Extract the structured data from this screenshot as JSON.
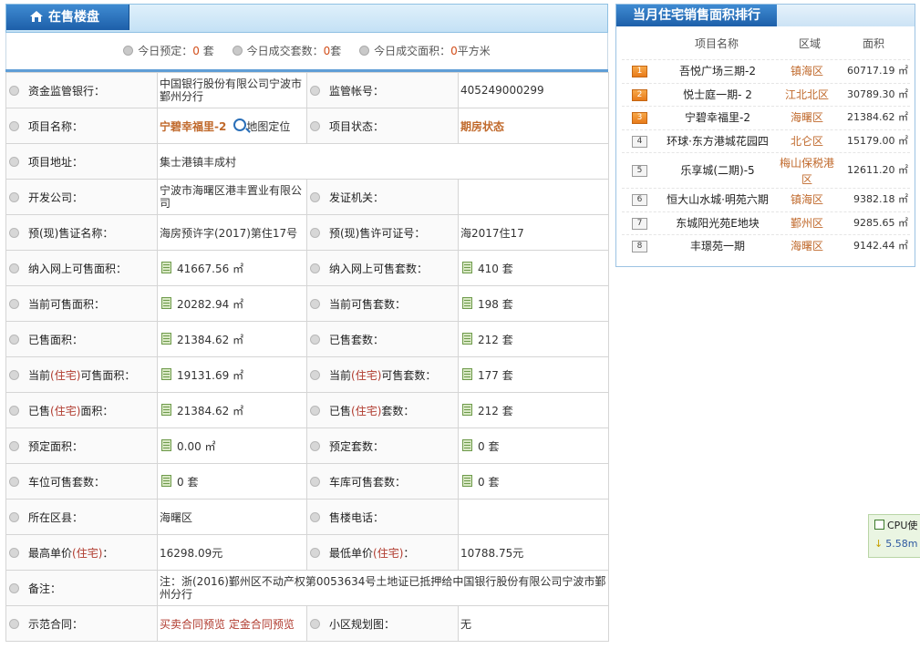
{
  "left_panel": {
    "tab_title": "在售楼盘",
    "stats": [
      {
        "label": "今日预定：",
        "value": "0",
        "unit": " 套"
      },
      {
        "label": "今日成交套数：",
        "value": "0",
        "unit": "套"
      },
      {
        "label": "今日成交面积：",
        "value": "0",
        "unit": "平方米"
      }
    ],
    "rows": {
      "bank_label": "资金监管银行：",
      "bank_value": "中国银行股份有限公司宁波市鄞州分行",
      "account_label": "监管帐号：",
      "account_value": "405249000299",
      "project_label": "项目名称：",
      "project_value": "宁碧幸福里-2",
      "map_link": "地图定位",
      "status_label": "项目状态：",
      "status_value": "期房状态",
      "address_label": "项目地址：",
      "address_value": "集士港镇丰成村",
      "developer_label": "开发公司：",
      "developer_value": "宁波市海曙区港丰置业有限公司",
      "issuer_label": "发证机关：",
      "issuer_value": "",
      "permit_name_label": "预(现)售证名称：",
      "permit_name_value": "海房预许字(2017)第住17号",
      "permit_no_label": "预(现)售许可证号：",
      "permit_no_value": "海2017住17",
      "online_area_label": "纳入网上可售面积：",
      "online_area_value": "41667.56 ㎡",
      "online_units_label": "纳入网上可售套数：",
      "online_units_value": "410 套",
      "cur_area_label": "当前可售面积：",
      "cur_area_value": "20282.94 ㎡",
      "cur_units_label": "当前可售套数：",
      "cur_units_value": "198 套",
      "sold_area_label": "已售面积：",
      "sold_area_value": "21384.62 ㎡",
      "sold_units_label": "已售套数：",
      "sold_units_value": "212 套",
      "cur_res_area_label_a": "当前",
      "cur_res_area_label_b": "(住宅)",
      "cur_res_area_label_c": "可售面积：",
      "cur_res_area_value": "19131.69 ㎡",
      "cur_res_units_label_a": "当前",
      "cur_res_units_label_b": "(住宅)",
      "cur_res_units_label_c": "可售套数：",
      "cur_res_units_value": "177 套",
      "sold_res_area_label_a": "已售",
      "sold_res_area_label_b": "(住宅)",
      "sold_res_area_label_c": "面积：",
      "sold_res_area_value": "21384.62 ㎡",
      "sold_res_units_label_a": "已售",
      "sold_res_units_label_b": "(住宅)",
      "sold_res_units_label_c": "套数：",
      "sold_res_units_value": "212 套",
      "reserved_area_label": "预定面积：",
      "reserved_area_value": "0.00 ㎡",
      "reserved_units_label": "预定套数：",
      "reserved_units_value": "0 套",
      "parking_label": "车位可售套数：",
      "parking_value": "0 套",
      "garage_label": "车库可售套数：",
      "garage_value": "0 套",
      "district_label": "所在区县：",
      "district_value": "海曙区",
      "phone_label": "售楼电话：",
      "phone_value": "",
      "max_price_label_a": "最高单价",
      "max_price_label_b": "(住宅)",
      "max_price_label_c": "：",
      "max_price_value": "16298.09元",
      "min_price_label_a": "最低单价",
      "min_price_label_b": "(住宅)",
      "min_price_label_c": "：",
      "min_price_value": "10788.75元",
      "note_label": "备注：",
      "note_value": "注：浙(2016)鄞州区不动产权第0053634号土地证已抵押给中国银行股份有限公司宁波市鄞州分行",
      "contract_label": "示范合同：",
      "contract_link1": "买卖合同预览",
      "contract_link2": "定金合同预览",
      "plan_label": "小区规划图：",
      "plan_value": "无"
    }
  },
  "right_panel": {
    "title": "当月住宅销售面积排行",
    "col_name": "项目名称",
    "col_area": "区域",
    "col_sqm": "面积",
    "items": [
      {
        "rank": "1",
        "name": "吾悦广场三期-2",
        "district": "镇海区",
        "sqm": "60717.19 ㎡"
      },
      {
        "rank": "2",
        "name": "悦士庭一期- 2",
        "district": "江北北区",
        "sqm": "30789.30 ㎡"
      },
      {
        "rank": "3",
        "name": "宁碧幸福里-2",
        "district": "海曙区",
        "sqm": "21384.62 ㎡"
      },
      {
        "rank": "4",
        "name": "环球·东方港城花园四",
        "district": "北仑区",
        "sqm": "15179.00 ㎡"
      },
      {
        "rank": "5",
        "name": "乐享城(二期)-5",
        "district": "梅山保税港区",
        "sqm": "12611.20 ㎡"
      },
      {
        "rank": "6",
        "name": "恒大山水城·明苑六期",
        "district": "镇海区",
        "sqm": "9382.18 ㎡"
      },
      {
        "rank": "7",
        "name": "东城阳光苑E地块",
        "district": "鄞州区",
        "sqm": "9285.65 ㎡"
      },
      {
        "rank": "8",
        "name": "丰璟苑一期",
        "district": "海曙区",
        "sqm": "9142.44 ㎡"
      }
    ]
  },
  "cpu_widget": {
    "line1": "CPU使",
    "line2": "5.58m"
  },
  "colors": {
    "accent_blue": "#1d5fa9",
    "highlight_orange": "#c0692b",
    "label_red": "#b03a2e"
  }
}
